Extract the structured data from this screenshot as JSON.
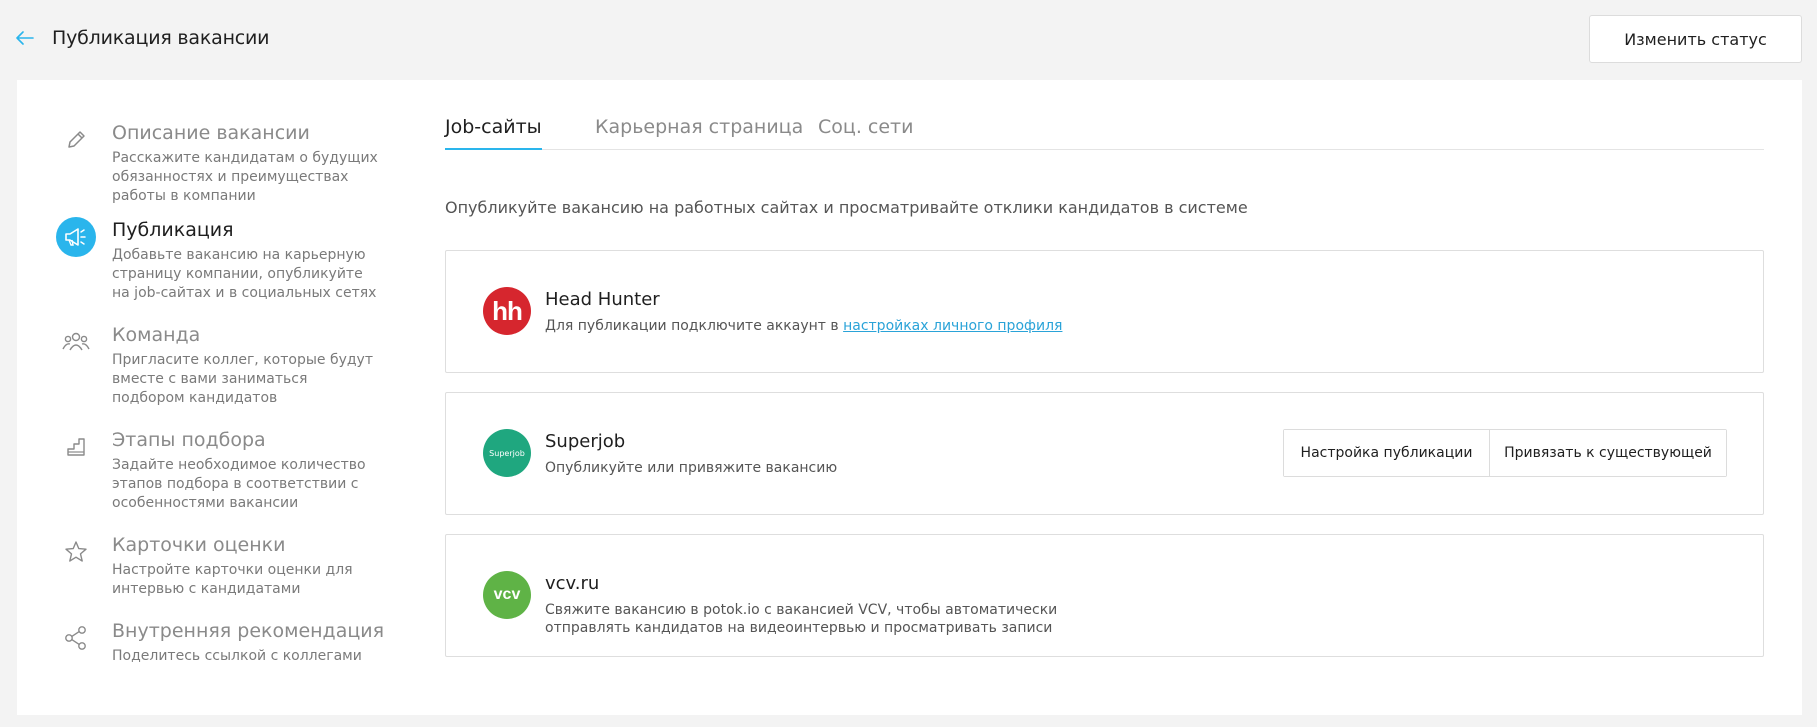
{
  "header": {
    "title": "Публикация вакансии",
    "status_button": "Изменить статус"
  },
  "sidebar": {
    "items": [
      {
        "title": "Описание вакансии",
        "desc": "Расскажите кандидатам о будущих обязанностях и преимуществах работы в компании",
        "icon": "pencil-icon"
      },
      {
        "title": "Публикация",
        "desc": "Добавьте вакансию на карьерную страницу компании, опубликуйте на job-сайтах и в социальных сетях",
        "icon": "megaphone-icon",
        "active": true
      },
      {
        "title": "Команда",
        "desc": "Пригласите коллег, которые будут вместе с вами заниматься подбором кандидатов",
        "icon": "team-icon"
      },
      {
        "title": "Этапы подбора",
        "desc": "Задайте необходимое количество этапов подбора в соответствии с особенностями вакансии",
        "icon": "stairs-icon"
      },
      {
        "title": "Карточки оценки",
        "desc": "Настройте карточки оценки для интервью с кандидатами",
        "icon": "star-icon"
      },
      {
        "title": "Внутренняя рекомендация",
        "desc": "Поделитесь ссылкой с коллегами",
        "icon": "share-icon"
      }
    ]
  },
  "tabs": [
    {
      "label": "Job-сайты",
      "active": true
    },
    {
      "label": "Карьерная страница"
    },
    {
      "label": "Соц. сети"
    }
  ],
  "intro": "Опубликуйте вакансию на работных сайтах и просматривайте отклики кандидатов в системе",
  "sites": [
    {
      "name": "Head Hunter",
      "logo_text": "hh",
      "logo_color": "#d6262e",
      "desc_prefix": "Для публикации подключите аккаунт в ",
      "desc_link": "настройках личного профиля"
    },
    {
      "name": "Superjob",
      "logo_text": "Superjob",
      "logo_color": "#1fa77f",
      "desc": "Опубликуйте или привяжите вакансию",
      "buttons": [
        "Настройка публикации",
        "Привязать к существующей"
      ]
    },
    {
      "name": "vcv.ru",
      "logo_text": "vcv",
      "logo_color": "#5fb346",
      "desc_line1": "Свяжите вакансию в potok.io с вакансией VCV, чтобы автоматически",
      "desc_line2": "отправлять кандидатов на видеоинтервью и просматривать записи"
    }
  ],
  "colors": {
    "accent": "#2ab5ec",
    "background": "#f3f3f3"
  }
}
